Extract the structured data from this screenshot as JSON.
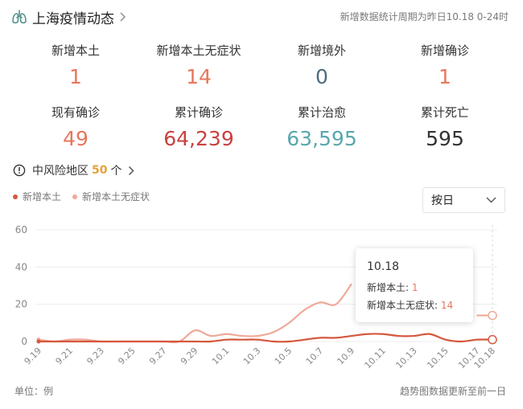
{
  "header": {
    "title": "上海疫情动态",
    "period": "新增数据统计周期为昨日10.18 0-24时"
  },
  "stats": [
    {
      "label": "新增本土",
      "value": "1",
      "color": "#e8765e"
    },
    {
      "label": "新增本土无症状",
      "value": "14",
      "color": "#e8765e"
    },
    {
      "label": "新增境外",
      "value": "0",
      "color": "#4d6c80"
    },
    {
      "label": "新增确诊",
      "value": "1",
      "color": "#e8765e"
    },
    {
      "label": "现有确诊",
      "value": "49",
      "color": "#e8765e"
    },
    {
      "label": "累计确诊",
      "value": "64,239",
      "color": "#c8423f"
    },
    {
      "label": "累计治愈",
      "value": "63,595",
      "color": "#5aa7ad"
    },
    {
      "label": "累计死亡",
      "value": "595",
      "color": "#333333"
    }
  ],
  "risk": {
    "prefix": "中风险地区",
    "count": "50",
    "suffix": "个"
  },
  "legend": [
    {
      "name": "新增本土",
      "color": "#d4583d"
    },
    {
      "name": "新增本土无症状",
      "color": "#f0a898"
    }
  ],
  "select": {
    "value": "按日"
  },
  "tooltip": {
    "date": "10.18",
    "rows": [
      {
        "label": "新增本土:",
        "value": "1"
      },
      {
        "label": "新增本土无症状:",
        "value": "14"
      }
    ]
  },
  "footer": {
    "unit": "单位：例",
    "note": "趋势图数据更新至前一日"
  },
  "chart_data": {
    "type": "line",
    "x": [
      "9.19",
      "9.20",
      "9.21",
      "9.22",
      "9.23",
      "9.24",
      "9.25",
      "9.26",
      "9.27",
      "9.28",
      "9.29",
      "9.30",
      "10.1",
      "10.2",
      "10.3",
      "10.4",
      "10.5",
      "10.6",
      "10.7",
      "10.8",
      "10.9",
      "10.10",
      "10.11",
      "10.12",
      "10.13",
      "10.14",
      "10.15",
      "10.16",
      "10.17",
      "10.18"
    ],
    "x_ticks": [
      "9.19",
      "9.21",
      "9.23",
      "9.25",
      "9.27",
      "9.29",
      "10.1",
      "10.3",
      "10.5",
      "10.7",
      "10.9",
      "10.11",
      "10.13",
      "10.15",
      "10.17",
      "10.18"
    ],
    "ylim": [
      0,
      60
    ],
    "yticks": [
      0,
      20,
      40,
      60
    ],
    "grid": true,
    "series": [
      {
        "name": "新增本土",
        "color": "#d4583d",
        "values": [
          0,
          0,
          0,
          0,
          0,
          0,
          0,
          0,
          0,
          0,
          0,
          0,
          1,
          1,
          1,
          0,
          0,
          1,
          2,
          2,
          3,
          4,
          4,
          3,
          3,
          4,
          1,
          0,
          1,
          1
        ]
      },
      {
        "name": "新增本土无症状",
        "color": "#f0a898",
        "values": [
          1,
          0,
          1,
          1,
          0,
          0,
          0,
          0,
          0,
          0,
          6,
          3,
          4,
          3,
          3,
          5,
          10,
          17,
          21,
          20,
          31,
          null,
          null,
          null,
          null,
          null,
          null,
          null,
          14,
          14
        ]
      }
    ]
  }
}
